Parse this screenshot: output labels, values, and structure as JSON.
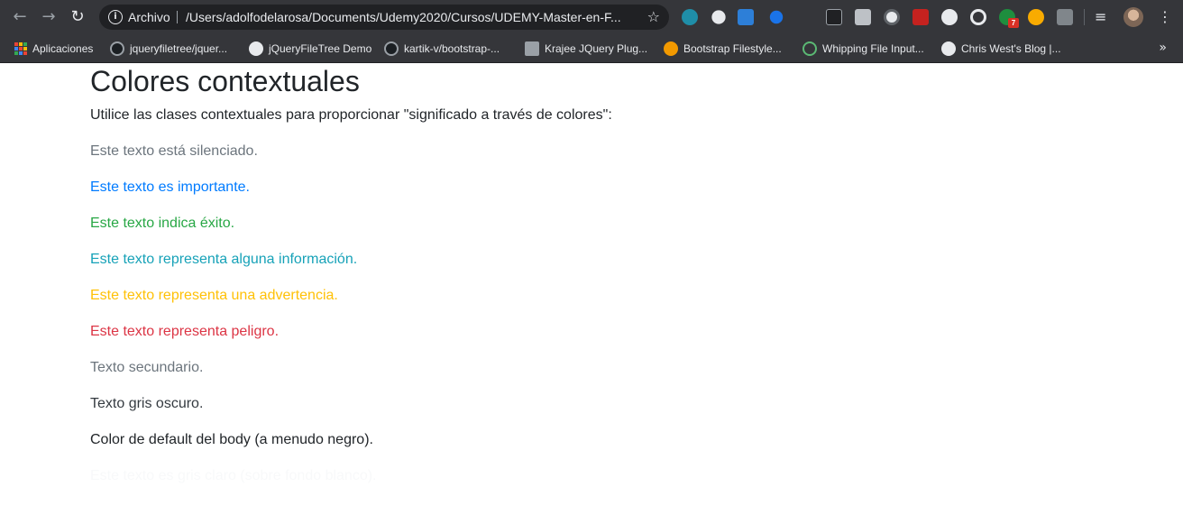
{
  "browser": {
    "scheme_label": "Archivo",
    "url": "/Users/adolfodelarosa/Documents/Udemy2020/Cursos/UDEMY-Master-en-F...",
    "extension_badge": "7",
    "extensions": [
      "chrome-ext-c-icon",
      "search-ext-icon",
      "s-ext-icon",
      "check-ext-icon",
      "terminal-ext-icon",
      "page-ext-icon",
      "circle-ext-icon",
      "off-ext-icon",
      "moon-ext-icon",
      "target-ext-icon",
      "green-ext-icon",
      "search-yellow-ext-icon",
      "code-ext-icon"
    ]
  },
  "bookmarks": [
    {
      "label": "Aplicaciones",
      "icon": "apps-grid-icon"
    },
    {
      "label": "jqueryfiletree/jquer...",
      "icon": "github-icon"
    },
    {
      "label": "jQueryFileTree Demo",
      "icon": "globe-icon"
    },
    {
      "label": "kartik-v/bootstrap-...",
      "icon": "github-icon"
    },
    {
      "label": "Krajee JQuery Plug...",
      "icon": "krajee-icon"
    },
    {
      "label": "Bootstrap Filestyle...",
      "icon": "fruit-icon"
    },
    {
      "label": "Whipping File Input...",
      "icon": "leaf-icon"
    },
    {
      "label": "Chris West's Blog |...",
      "icon": "globe-icon"
    }
  ],
  "page": {
    "title": "Colores contextuales",
    "intro": "Utilice las clases contextuales para proporcionar \"significado a través de colores\":",
    "lines": [
      {
        "text": "Este texto está silenciado.",
        "color": "#6c757d"
      },
      {
        "text": "Este texto es importante.",
        "color": "#007bff"
      },
      {
        "text": "Este texto indica éxito.",
        "color": "#28a745"
      },
      {
        "text": "Este texto representa alguna información.",
        "color": "#17a2b8"
      },
      {
        "text": "Este texto representa una advertencia.",
        "color": "#ffc107"
      },
      {
        "text": "Este texto representa peligro.",
        "color": "#dc3545"
      },
      {
        "text": "Texto secundario.",
        "color": "#6c757d"
      },
      {
        "text": "Texto gris oscuro.",
        "color": "#343a40"
      },
      {
        "text": "Color de default del body (a menudo negro).",
        "color": "#212529"
      },
      {
        "text": "Este texto es gris claro (sobre fondo blanco).",
        "color": "#f8f9fa"
      }
    ]
  }
}
